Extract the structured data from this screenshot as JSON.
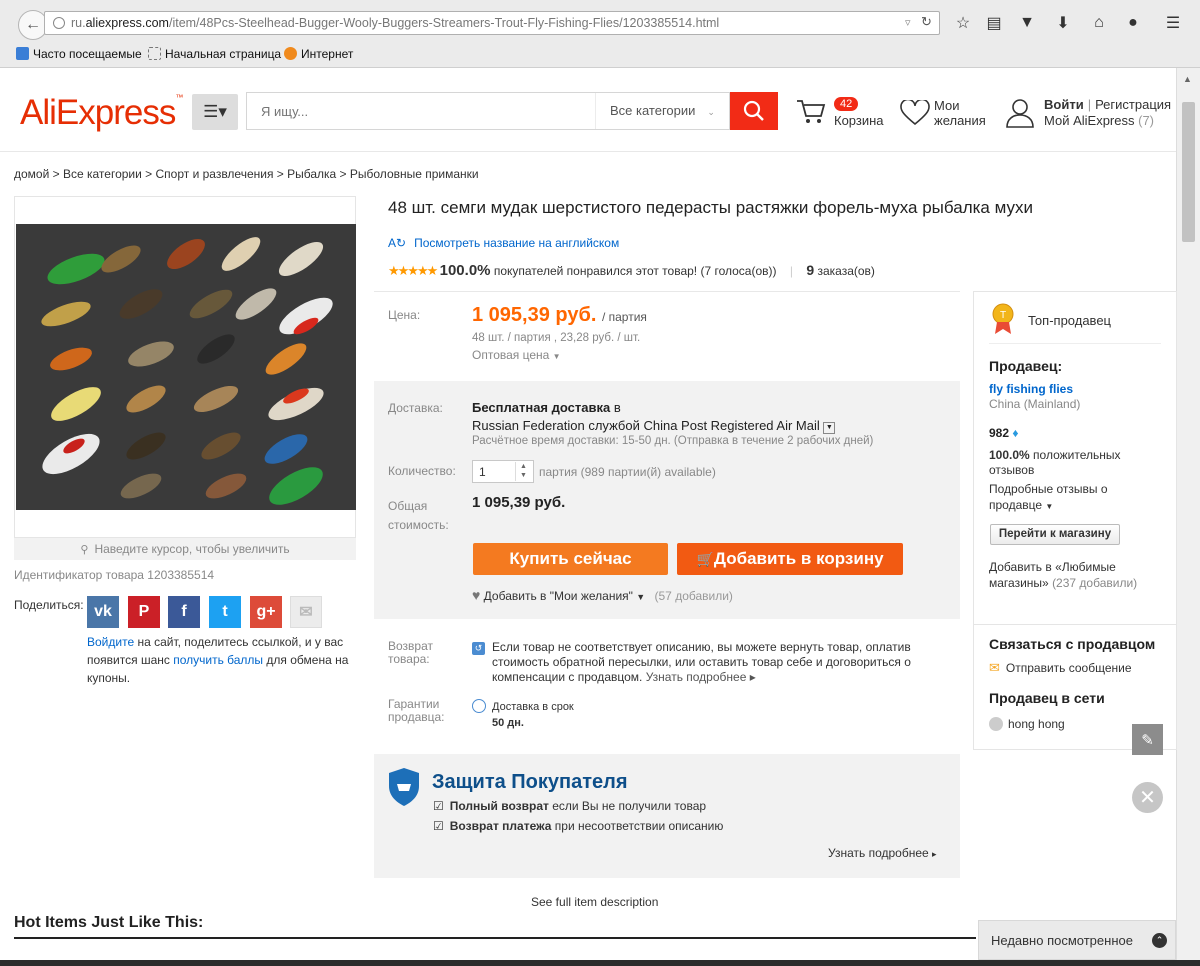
{
  "browser": {
    "url_prefix": "ru.",
    "url_domain": "aliexpress.com",
    "url_path": "/item/48Pcs-Steelhead-Bugger-Wooly-Buggers-Streamers-Trout-Fly-Fishing-Flies/1203385514.html",
    "bookmarks": [
      "Часто посещаемые",
      "Начальная страница",
      "Интернет"
    ]
  },
  "header": {
    "logo": "AliExpress",
    "logo_tm": "™",
    "search_placeholder": "Я ищу...",
    "category_select": "Все категории",
    "cart_count": "42",
    "cart_label": "Корзина",
    "wish_line1": "Мои",
    "wish_line2": "желания",
    "login": "Войти",
    "register": "Регистрация",
    "my_ali": "Мой AliExpress",
    "my_ali_count": "(7)"
  },
  "breadcrumb": "домой > Все категории > Спорт и развлечения > Рыбалка > Рыболовные приманки",
  "gallery": {
    "zoom_hint": "Наведите курсор, чтобы увеличить",
    "product_id": "Идентификатор товара 1203385514"
  },
  "share": {
    "label": "Поделиться:",
    "networks": [
      "vk",
      "pinterest",
      "facebook",
      "twitter",
      "google-plus",
      "email"
    ],
    "text_link1": "Войдите",
    "text_mid": " на сайт, поделитесь ссылкой, и у вас появится шанс ",
    "text_link2": "получить баллы",
    "text_end": " для обмена на купоны."
  },
  "product": {
    "title": "48 шт. семги мудак шерстистого педерасты растяжки форель-муха рыбалка мухи",
    "translate": "Посмотреть название на английском",
    "rating_pct": "100.0%",
    "rating_text": "покупателей понравился этот товар! (7 голоса(ов))",
    "orders_count": "9",
    "orders_label": "заказа(ов)",
    "stars": 5
  },
  "price": {
    "label": "Цена:",
    "value": "1 095,39 руб.",
    "unit": "/ партия",
    "sub": "48 шт. / партия , 23,28 руб. / шт.",
    "wholesale": "Оптовая цена"
  },
  "shipping": {
    "label": "Доставка:",
    "free": "Бесплатная доставка",
    "to": "в",
    "method": "Russian Federation службой China Post Registered Air Mail",
    "time": "Расчётное время доставки: 15-50 дн. (Отправка в течение 2 рабочих дней)"
  },
  "quantity": {
    "label": "Количество:",
    "value": "1",
    "avail": "партия (989 партии(й) available)"
  },
  "total": {
    "label1": "Общая",
    "label2": "стоимость:",
    "value": "1 095,39 руб."
  },
  "buttons": {
    "buy": "Купить сейчас",
    "cart": "Добавить в корзину",
    "wishlist": "Добавить в \"Мои желания\"",
    "wishlist_count": "(57 добавили)"
  },
  "returns": {
    "label1": "Возврат",
    "label2": "товара:",
    "text": "Если товар не соответствует описанию, вы можете вернуть товар, оплатив стоимость обратной пересылки, или оставить товар себе и договориться о компенсации с продавцом.",
    "more": "Узнать подробнее"
  },
  "guarantee": {
    "label1": "Гарантии",
    "label2": "продавца:",
    "line1": "Доставка в срок",
    "line2": "50 дн."
  },
  "protection": {
    "title": "Защита Покупателя",
    "line1_bold": "Полный возврат",
    "line1_rest": " если Вы не получили товар",
    "line2_bold": "Возврат платежа",
    "line2_rest": " при несоответствии описанию",
    "more": "Узнать подробнее"
  },
  "full_description": "See full item description",
  "seller": {
    "badge": "Топ-продавец",
    "heading": "Продавец:",
    "store": "fly fishing flies",
    "country": "China (Mainland)",
    "score": "982",
    "positive_pct": "100.0%",
    "positive_text": " положительных отзывов",
    "detail": "Подробные отзывы о продавце",
    "goto": "Перейти к магазину",
    "fav_text": "Добавить в «Любимые магазины»",
    "fav_count": "(237 добавили)",
    "contact_heading": "Связаться с продавцом",
    "send_msg": "Отправить сообщение",
    "online_heading": "Продавец в сети",
    "online_user": "hong hong"
  },
  "bottom": {
    "hot_items": "Hot Items Just Like This:",
    "recent": "Недавно посмотренное"
  },
  "colors": {
    "brand": "#e62e04",
    "buy": "#f47a20",
    "cart": "#f25a12",
    "link": "#0066cc",
    "protection": "#0e4f8a"
  }
}
